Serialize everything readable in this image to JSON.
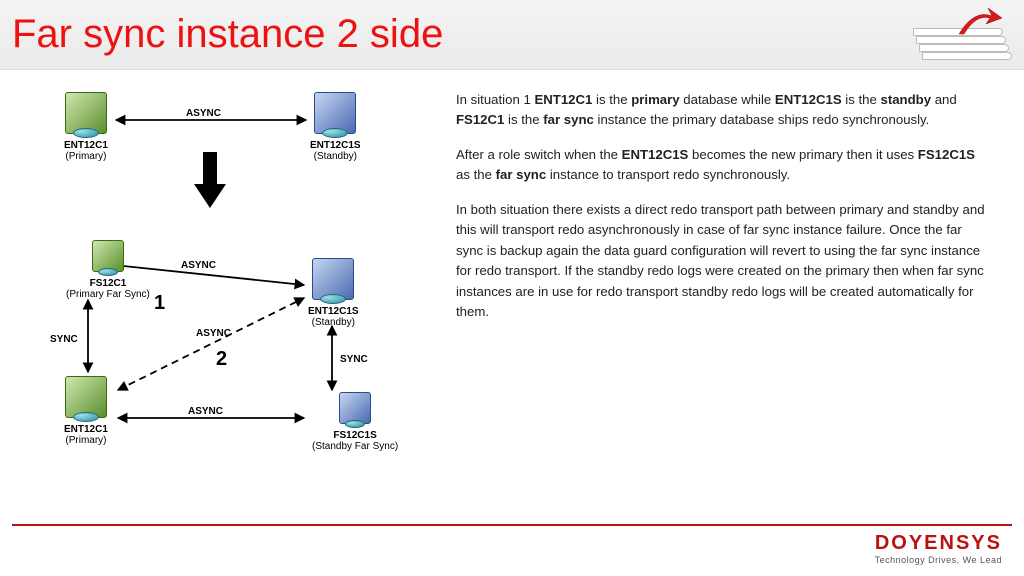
{
  "header": {
    "title": "Far sync instance 2 side"
  },
  "nodes": {
    "n1_name": "ENT12C1",
    "n1_role": "(Primary)",
    "n2_name": "ENT12C1S",
    "n2_role": "(Standby)",
    "n3_name": "FS12C1",
    "n3_role": "(Primary Far Sync)",
    "n4_name": "ENT12C1S",
    "n4_role": "(Standby)",
    "n5_name": "ENT12C1",
    "n5_role": "(Primary)",
    "n6_name": "FS12C1S",
    "n6_role": "(Standby Far Sync)"
  },
  "edge_labels": {
    "top_async": "ASYNC",
    "mid_async": "ASYNC",
    "diag_async": "ASYNC",
    "bot_async": "ASYNC",
    "left_sync": "SYNC",
    "right_sync": "SYNC"
  },
  "big": {
    "one": "1",
    "two": "2"
  },
  "paras": {
    "p1a": "In situation 1 ",
    "p1b": "ENT12C1",
    "p1c": " is the ",
    "p1d": "primary",
    "p1e": " database while ",
    "p1f": "ENT12C1S",
    "p1g": " is the ",
    "p1h": "standby",
    "p1i": " and ",
    "p1j": "FS12C1",
    "p1k": " is the ",
    "p1l": "far sync",
    "p1m": " instance the primary database ships  redo synchronously.",
    "p2a": "After a role switch when the ",
    "p2b": "ENT12C1S",
    "p2c": " becomes the new primary then it uses ",
    "p2d": "FS12C1S",
    "p2e": " as the ",
    "p2f": "far sync",
    "p2g": " instance to transport redo synchronously.",
    "p3": "In both situation there exists a direct redo transport path between primary and standby and this will transport redo asynchronously in case of far sync instance failure. Once the far sync is backup again the data guard configuration will revert to using the far sync instance for redo transport. If the standby redo logs were created on the primary then when far sync instances are in use for redo transport standby redo logs will be created automatically for them."
  },
  "footer": {
    "brand": "DOYENSYS",
    "tagline": "Technology Drives, We Lead"
  }
}
